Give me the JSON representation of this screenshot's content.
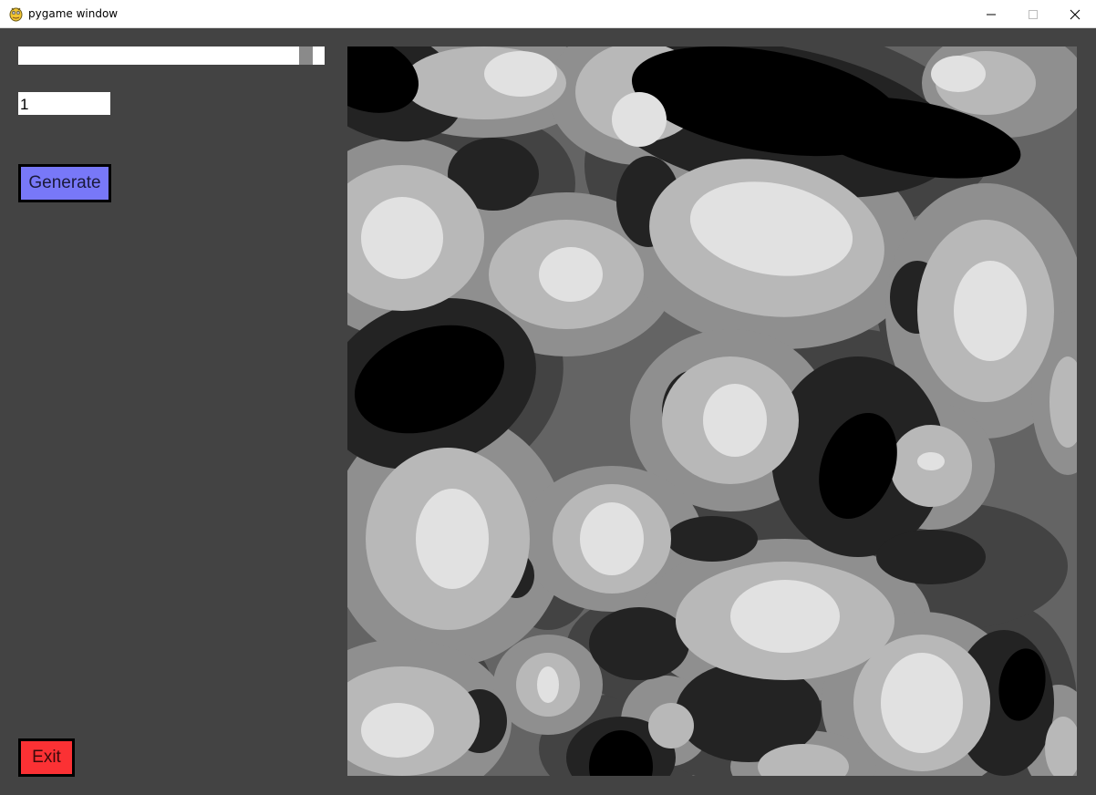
{
  "window": {
    "title": "pygame window",
    "icon": "pygame-snake-icon",
    "controls": [
      "minimize-icon",
      "maximize-icon",
      "close-icon"
    ]
  },
  "controls": {
    "slider": {
      "value_fraction": 0.96
    },
    "seed_input": {
      "value": "1"
    },
    "generate_label": "Generate",
    "exit_label": "Exit"
  },
  "colors": {
    "background": "#434343",
    "generate_button": "#7878f8",
    "exit_button": "#fb3134",
    "noise_levels": [
      "#000000",
      "#232323",
      "#434343",
      "#646464",
      "#8f8f8f",
      "#b8b8b8",
      "#e1e1e1"
    ]
  }
}
